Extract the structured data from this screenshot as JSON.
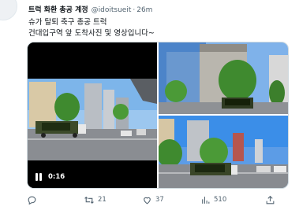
{
  "tweet": {
    "display_name": "트럭 화환 총공 계정",
    "handle": "@idoitsueit",
    "separator": "·",
    "time": "26m",
    "text_line1": "슈가 탈퇴 축구 총공 트럭",
    "text_line2": "건대입구역 앞 도착사진 및 영상입니다~"
  },
  "media": {
    "video_duration": "0:16"
  },
  "actions": {
    "reply_count": "",
    "retweet_count": "21",
    "like_count": "37",
    "views_count": "510"
  },
  "colors": {
    "text": "#0f1419",
    "muted": "#536471",
    "sky": "#3b8ee8",
    "tree": "#3f8a2f",
    "road": "#8a8d92"
  },
  "icons": [
    "reply-icon",
    "retweet-icon",
    "heart-icon",
    "views-icon",
    "share-icon",
    "pause-icon"
  ]
}
